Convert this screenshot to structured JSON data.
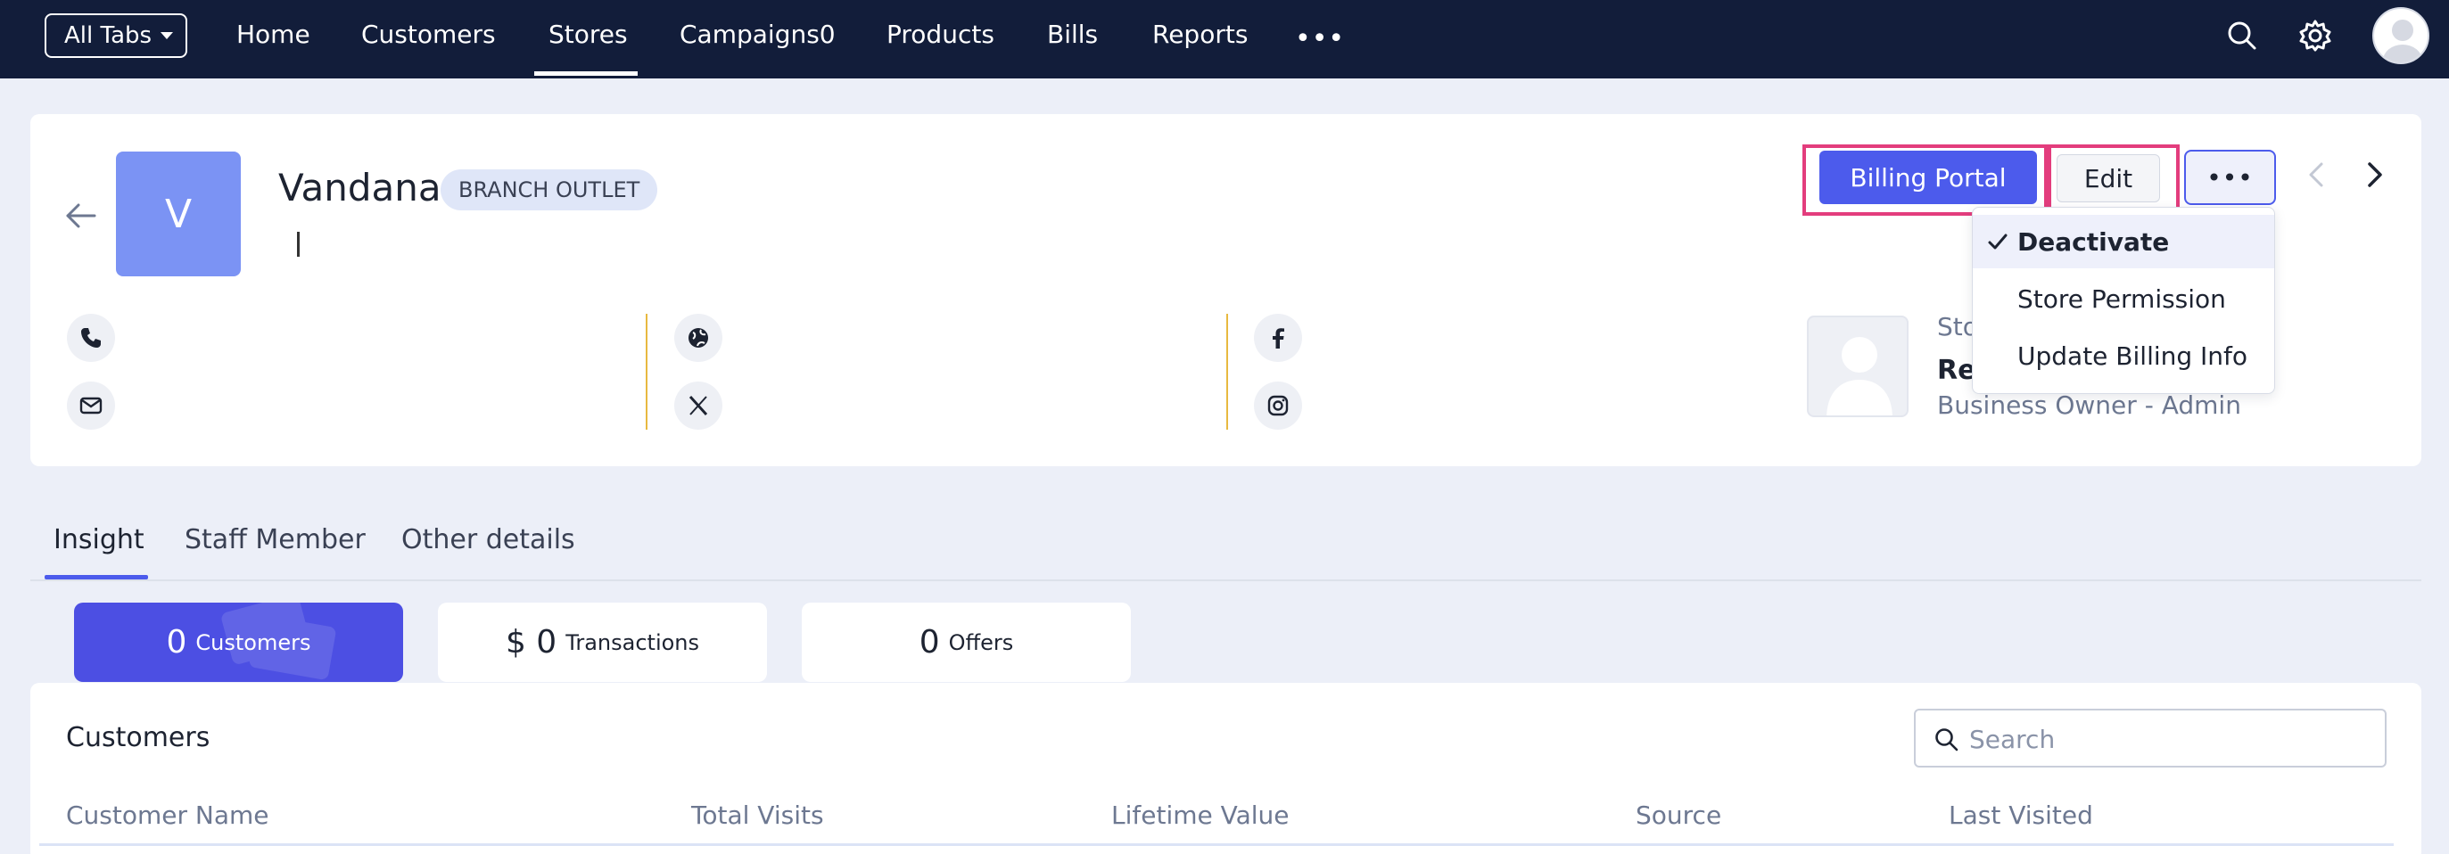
{
  "topnav": {
    "all_tabs_label": "All Tabs",
    "items": [
      "Home",
      "Customers",
      "Stores",
      "Campaigns0",
      "Products",
      "Bills",
      "Reports"
    ],
    "active_item": "Stores",
    "more_label": "•••"
  },
  "store": {
    "avatar_letter": "V",
    "name": "Vandana",
    "badge": "BRANCH OUTLET"
  },
  "owner": {
    "label_partial": "Sto",
    "name_partial": "Re",
    "role": "Business Owner - Admin"
  },
  "actions": {
    "billing_portal_label": "Billing Portal",
    "edit_label": "Edit",
    "more_label": "•••"
  },
  "dropdown": {
    "items": [
      "Deactivate",
      "Store Permission",
      "Update Billing Info"
    ],
    "checked_item": "Deactivate"
  },
  "tabs": {
    "items": [
      "Insight",
      "Staff Member",
      "Other details"
    ],
    "active": "Insight"
  },
  "stats": [
    {
      "value": "0",
      "label": "Customers"
    },
    {
      "value": "$ 0",
      "label": "Transactions"
    },
    {
      "value": "0",
      "label": "Offers"
    }
  ],
  "customers_section": {
    "title": "Customers",
    "search_placeholder": "Search",
    "columns": [
      "Customer Name",
      "Total Visits",
      "Lifetime Value",
      "Source",
      "Last Visited"
    ]
  },
  "colors": {
    "nav_bg": "#121d3a",
    "accent": "#4c5bec",
    "highlight": "#e33d7d",
    "divider": "#e8b940"
  },
  "icons": [
    "caret-down-icon",
    "more-dots-icon",
    "search-icon",
    "gear-icon",
    "user-avatar-icon",
    "back-arrow-icon",
    "phone-icon",
    "email-icon",
    "globe-icon",
    "x-twitter-icon",
    "facebook-icon",
    "instagram-icon",
    "chevron-left-icon",
    "chevron-right-icon",
    "check-icon"
  ]
}
